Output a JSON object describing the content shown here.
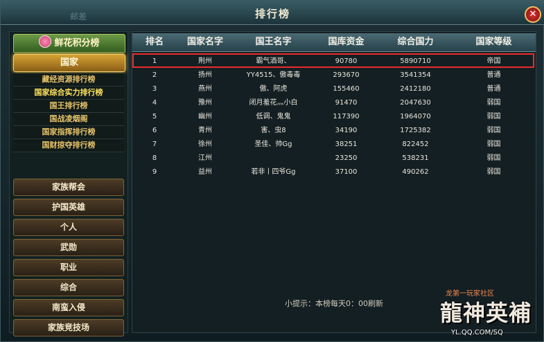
{
  "window": {
    "title": "排行榜",
    "ghost_tab": "邮差",
    "close_symbol": "✕"
  },
  "sidebar": {
    "flower_tab": "鲜花积分榜",
    "nation_tab": "国家",
    "sub_items": [
      {
        "label": "藏经资源排行榜",
        "active": false
      },
      {
        "label": "国家综合实力排行榜",
        "active": true
      },
      {
        "label": "国王排行榜",
        "active": false
      },
      {
        "label": "国战凌烟阁",
        "active": false
      },
      {
        "label": "国家指挥排行榜",
        "active": false
      },
      {
        "label": "国财掠夺排行榜",
        "active": false
      }
    ],
    "categories": [
      "家族帮会",
      "护国英雄",
      "个人",
      "武勋",
      "职业",
      "综合",
      "南蛮入侵",
      "家族竞技场"
    ]
  },
  "table": {
    "headers": [
      "排名",
      "国家名字",
      "国王名字",
      "国库资金",
      "综合国力",
      "国家等级"
    ],
    "rows": [
      [
        "1",
        "荆州",
        "霸气酒哥、",
        "90780",
        "5890710",
        "帝国"
      ],
      [
        "2",
        "扬州",
        "YY4515、傲毒毒",
        "293670",
        "3541354",
        "普通"
      ],
      [
        "3",
        "燕州",
        "傲、阿虎",
        "155460",
        "2412180",
        "普通"
      ],
      [
        "4",
        "豫州",
        "闭月羞花灬小白",
        "91470",
        "2047630",
        "弱国"
      ],
      [
        "5",
        "幽州",
        "低调、鬼鬼",
        "117390",
        "1964070",
        "弱国"
      ],
      [
        "6",
        "青州",
        "害、虫8",
        "34190",
        "1725382",
        "弱国"
      ],
      [
        "7",
        "徐州",
        "圣佳、帅Gg",
        "38251",
        "822452",
        "弱国"
      ],
      [
        "8",
        "江州",
        "",
        "23250",
        "538231",
        "弱国"
      ],
      [
        "9",
        "益州",
        "若非丨四爷Gg",
        "37100",
        "490262",
        "弱国"
      ]
    ],
    "highlighted_row": 1
  },
  "hint": "小提示：本榜每天0：00刷新",
  "logo": {
    "tagline": "龙第一玩家社区",
    "name": "龍神英補",
    "url": "YL.QQ.COM/SQ"
  },
  "colors": {
    "highlight_border": "#ee2a2a",
    "active_tab": "#d6a232",
    "active_sub_item": "#ffe55c"
  }
}
